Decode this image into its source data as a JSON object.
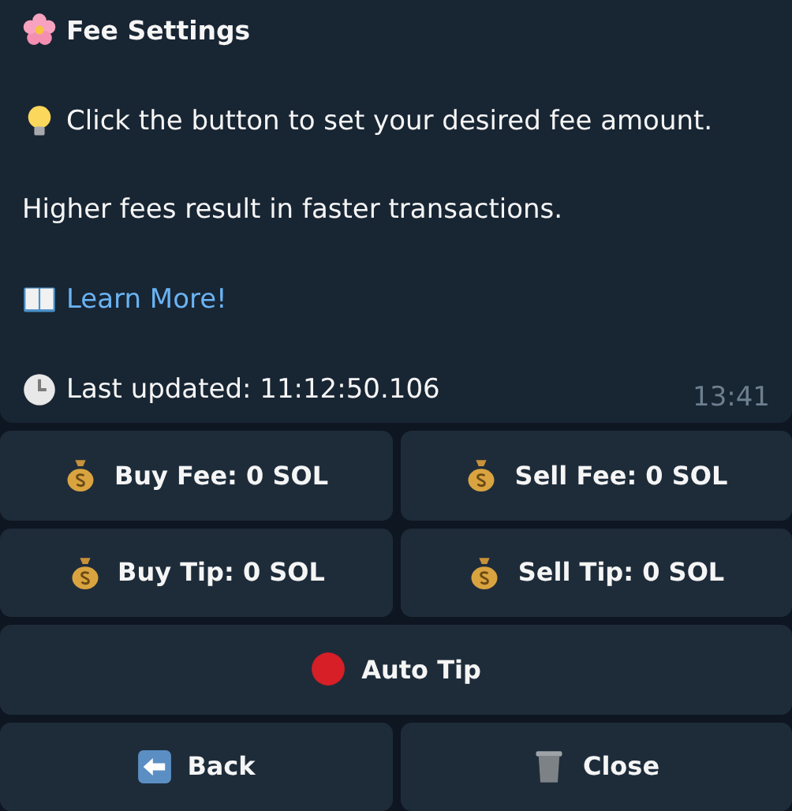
{
  "message": {
    "title": "Fee Settings",
    "tip": "Click the button to set your desired fee amount.",
    "note": "Higher fees result in faster transactions.",
    "link": "Learn More!",
    "updated": "Last updated: 11:12:50.106",
    "time": "13:41"
  },
  "keyboard": [
    [
      {
        "label": "Buy Fee: 0 SOL"
      },
      {
        "label": "Sell Fee: 0 SOL"
      }
    ],
    [
      {
        "label": "Buy Tip: 0 SOL"
      },
      {
        "label": "Sell Tip: 0 SOL"
      }
    ],
    [
      {
        "label": "Auto Tip"
      }
    ],
    [
      {
        "label": "Back"
      },
      {
        "label": "Close"
      }
    ]
  ]
}
